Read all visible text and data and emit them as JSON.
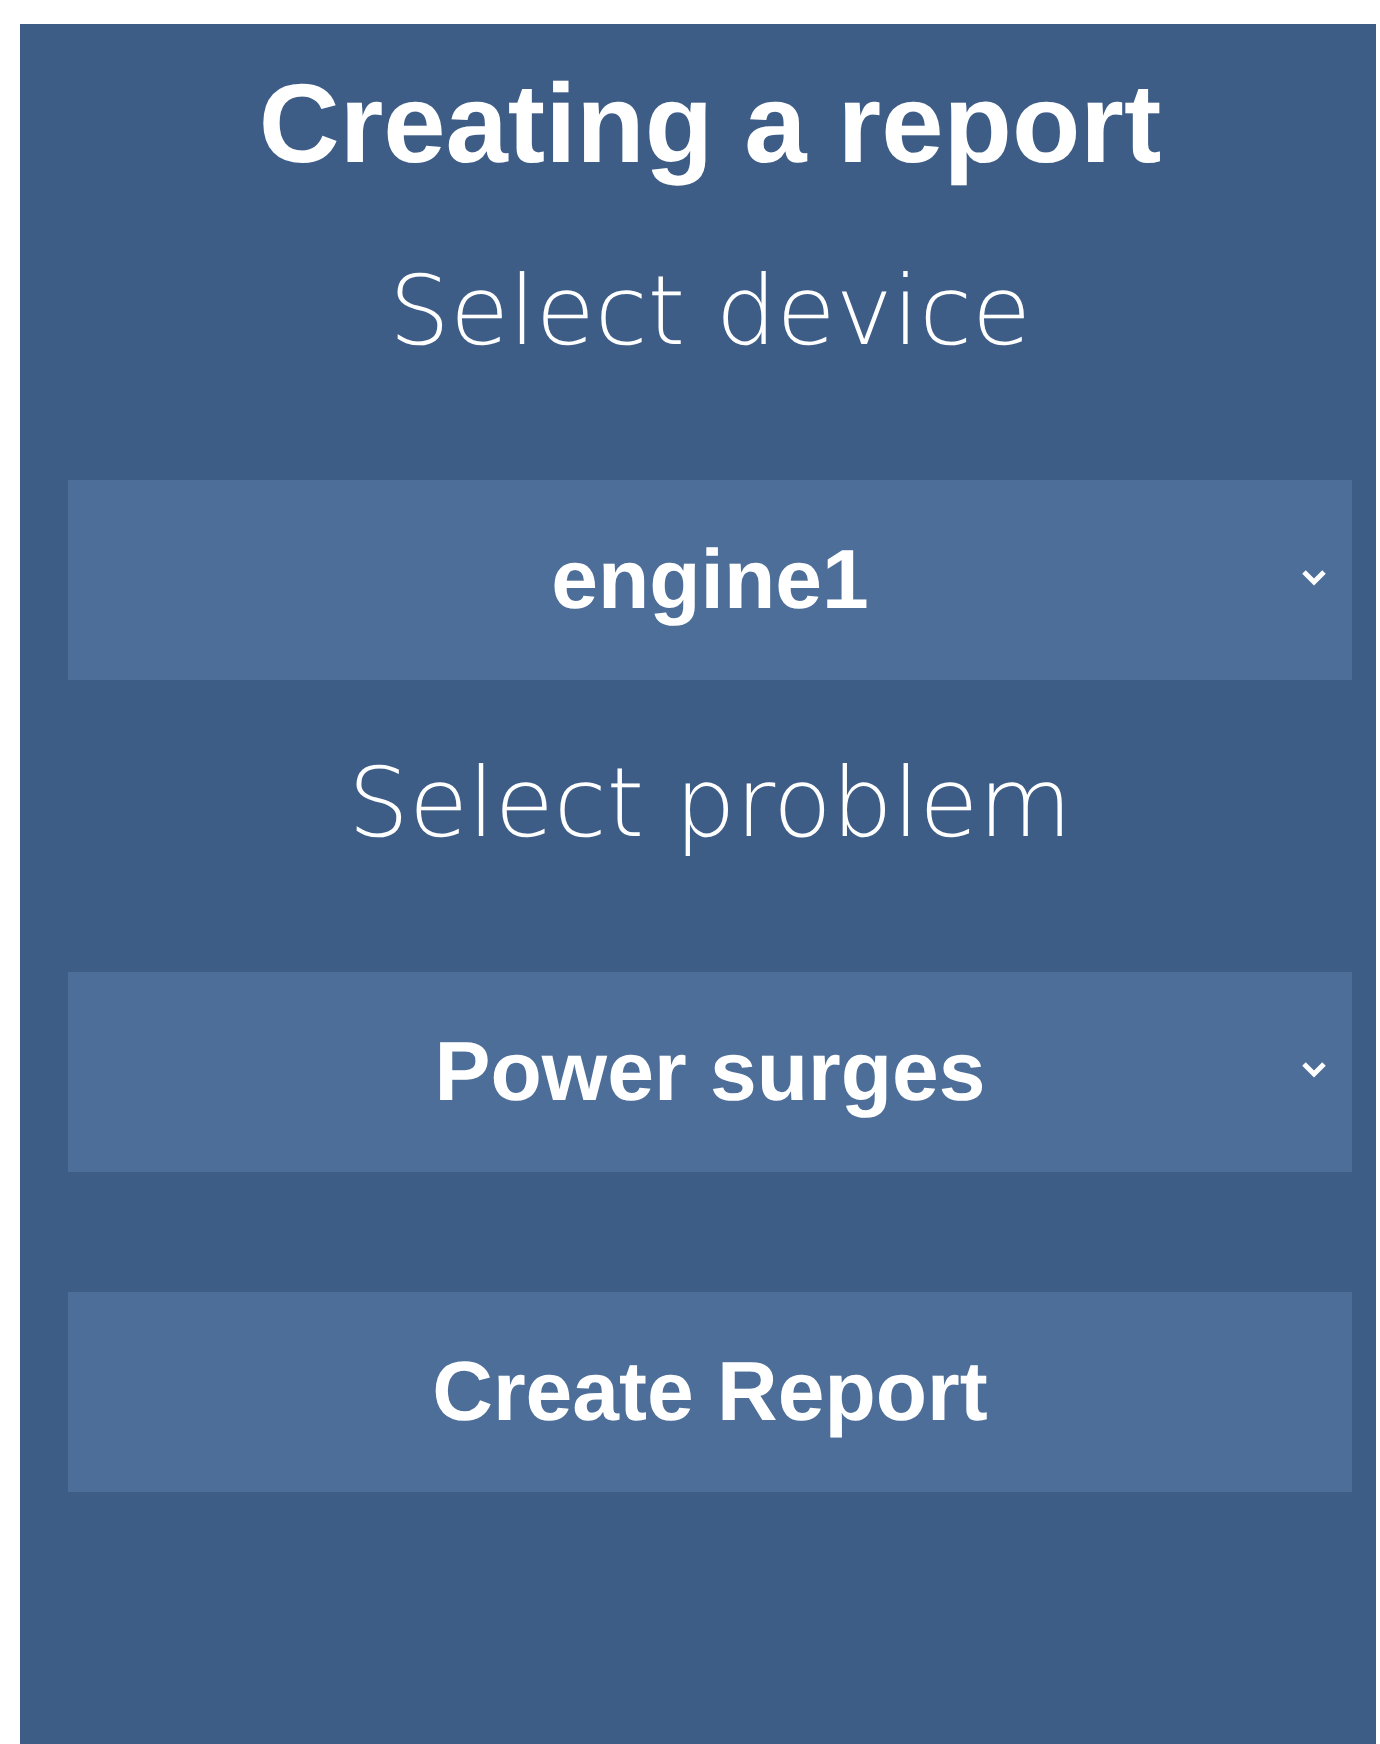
{
  "title": "Creating a report",
  "fields": [
    {
      "label": "Select device",
      "value": "engine1"
    },
    {
      "label": "Select problem",
      "value": "Power surges"
    }
  ],
  "button": "Create Report"
}
